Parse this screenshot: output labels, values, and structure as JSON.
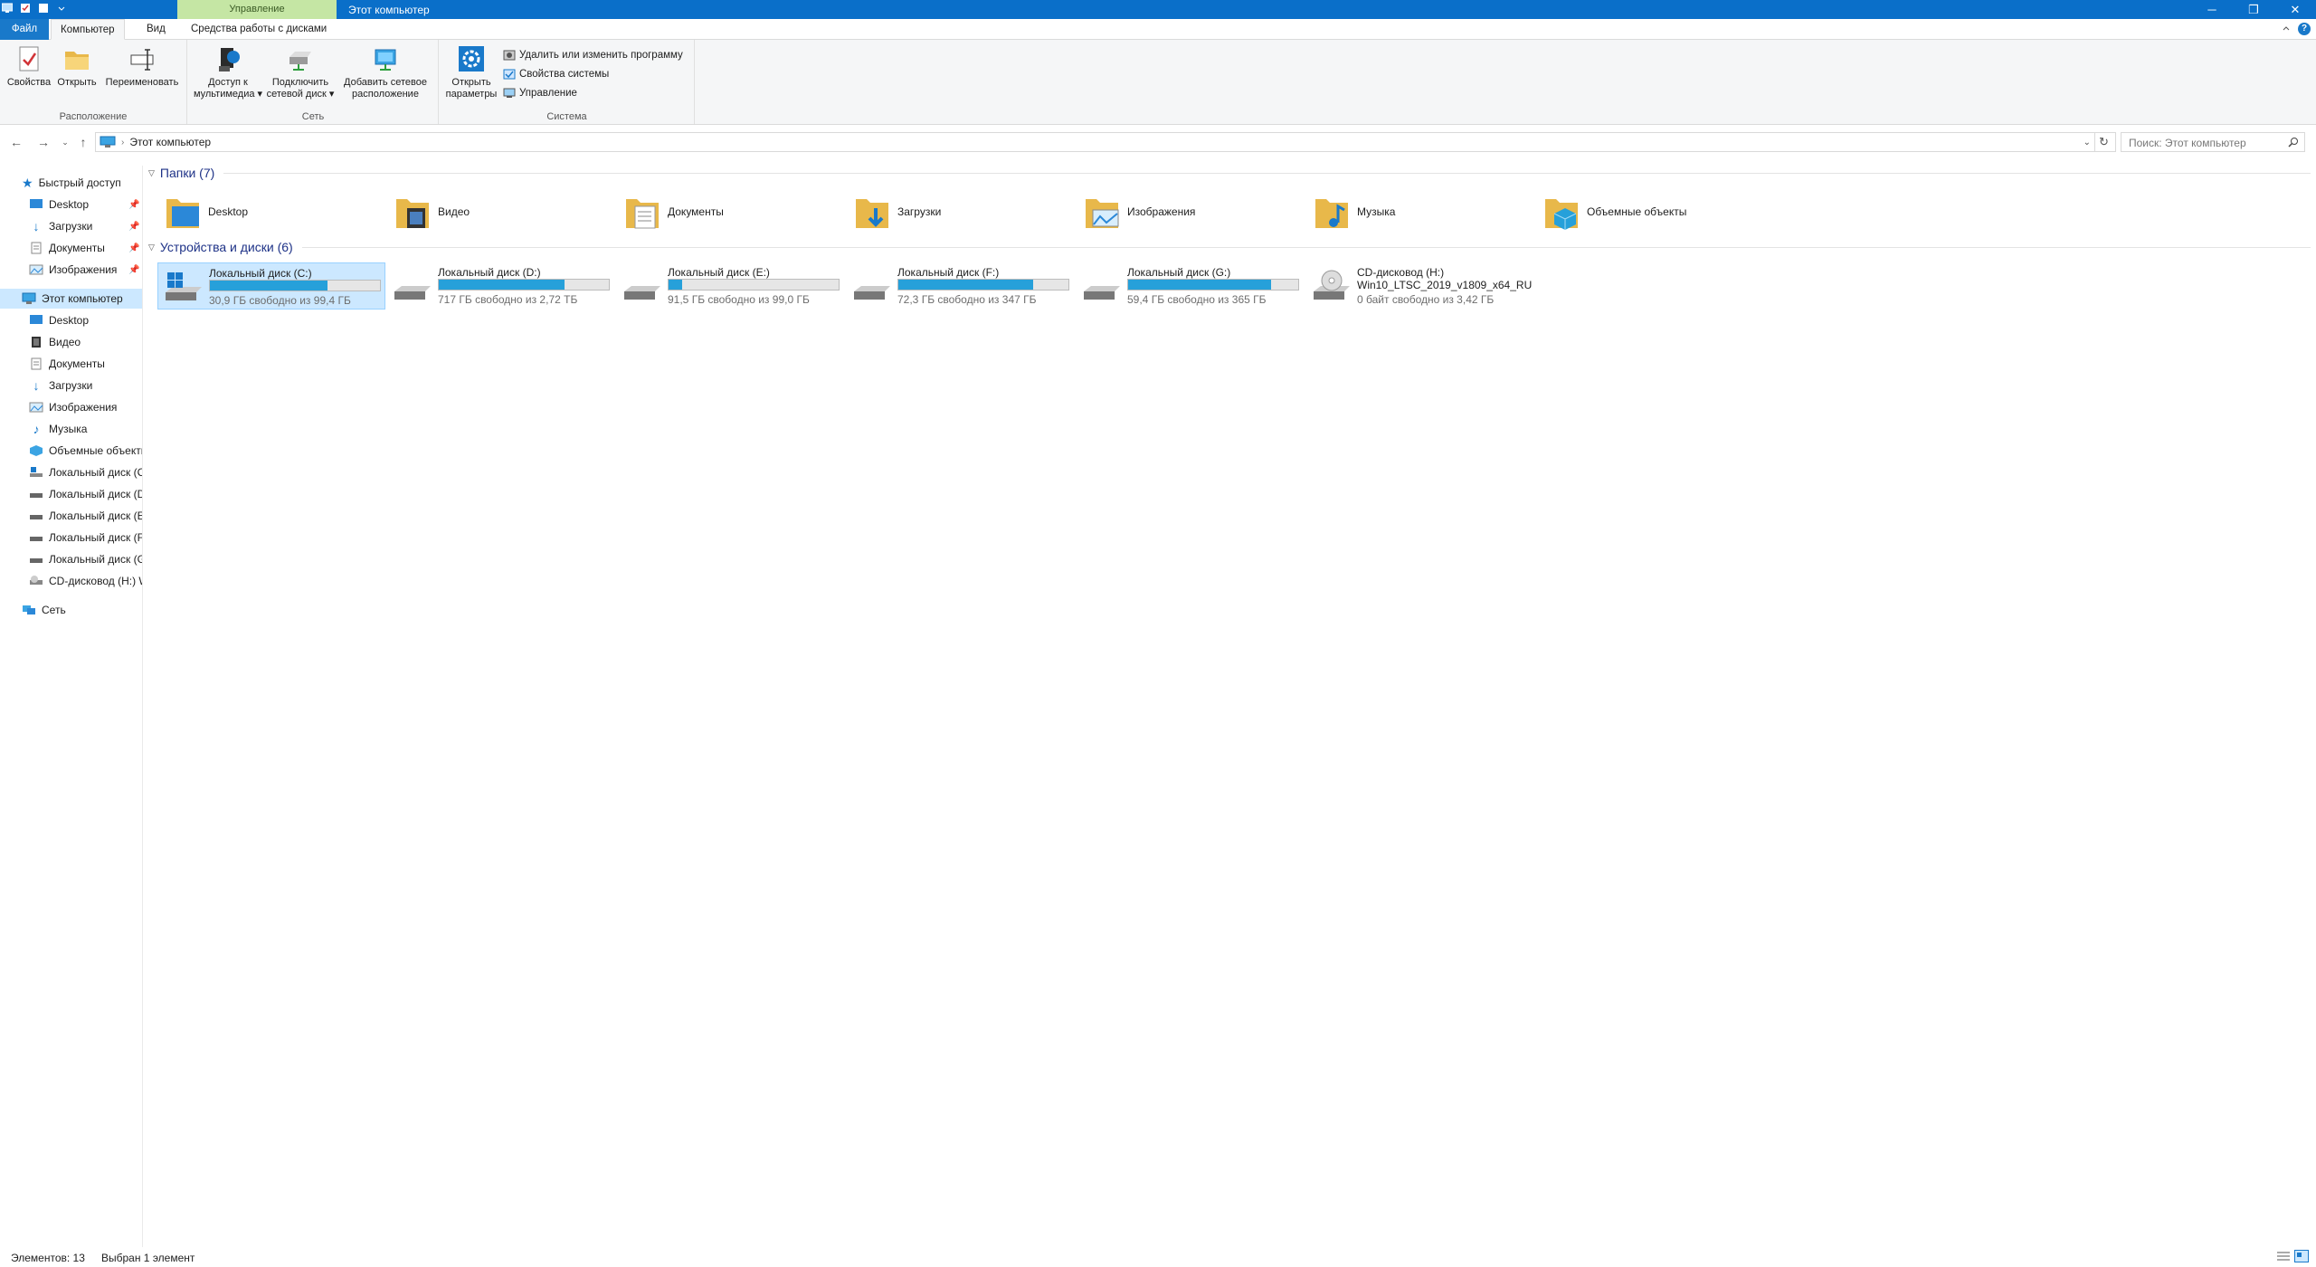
{
  "titlebar": {
    "context_tab": "Управление",
    "title": "Этот компьютер",
    "minimize": "─",
    "restore": "❐",
    "close": "✕"
  },
  "ribbon_tabs": {
    "file": "Файл",
    "computer": "Компьютер",
    "view": "Вид",
    "drive_tools": "Средства работы с дисками"
  },
  "ribbon": {
    "groups": {
      "location": "Расположение",
      "network": "Сеть",
      "system": "Система"
    },
    "buttons": {
      "properties": "Свойства",
      "open": "Открыть",
      "rename": "Переименовать",
      "media_access_1": "Доступ к",
      "media_access_2": "мультимедиа ▾",
      "map_drive_1": "Подключить",
      "map_drive_2": "сетевой диск ▾",
      "add_location_1": "Добавить сетевое",
      "add_location_2": "расположение",
      "open_settings_1": "Открыть",
      "open_settings_2": "параметры",
      "uninstall": "Удалить или изменить программу",
      "system_properties": "Свойства системы",
      "manage": "Управление"
    }
  },
  "address": {
    "path": "Этот компьютер",
    "search_placeholder": "Поиск: Этот компьютер"
  },
  "nav": {
    "quick_access": "Быстрый доступ",
    "quick_items": [
      "Desktop",
      "Загрузки",
      "Документы",
      "Изображения"
    ],
    "this_pc": "Этот компьютер",
    "pc_items": [
      "Desktop",
      "Видео",
      "Документы",
      "Загрузки",
      "Изображения",
      "Музыка",
      "Объемные объекты",
      "Локальный диск (C",
      "Локальный диск (D",
      "Локальный диск (E",
      "Локальный диск (F",
      "Локальный диск (G",
      "CD-дисковод (H:) W"
    ],
    "network": "Сеть"
  },
  "folders": {
    "header": "Папки (7)",
    "items": [
      "Desktop",
      "Видео",
      "Документы",
      "Загрузки",
      "Изображения",
      "Музыка",
      "Объемные объекты"
    ]
  },
  "drives": {
    "header": "Устройства и диски (6)",
    "items": [
      {
        "name": "Локальный диск (C:)",
        "free": "30,9 ГБ свободно из 99,4 ГБ",
        "used_fraction": 0.69
      },
      {
        "name": "Локальный диск (D:)",
        "free": "717 ГБ свободно из 2,72 ТБ",
        "used_fraction": 0.74
      },
      {
        "name": "Локальный диск (E:)",
        "free": "91,5 ГБ свободно из 99,0 ГБ",
        "used_fraction": 0.08
      },
      {
        "name": "Локальный диск (F:)",
        "free": "72,3 ГБ свободно из 347 ГБ",
        "used_fraction": 0.79
      },
      {
        "name": "Локальный диск (G:)",
        "free": "59,4 ГБ свободно из 365 ГБ",
        "used_fraction": 0.84
      }
    ],
    "cd": {
      "name": "CD-дисковод (H:)",
      "label": "Win10_LTSC_2019_v1809_x64_RU",
      "free": "0 байт свободно из 3,42 ГБ"
    }
  },
  "status": {
    "count": "Элементов: 13",
    "selected": "Выбран 1 элемент"
  },
  "colors": {
    "accent": "#0a6fc9",
    "selection": "#cce8ff",
    "bar_fill": "#26a0da",
    "context_tab": "#c5e6a4"
  }
}
